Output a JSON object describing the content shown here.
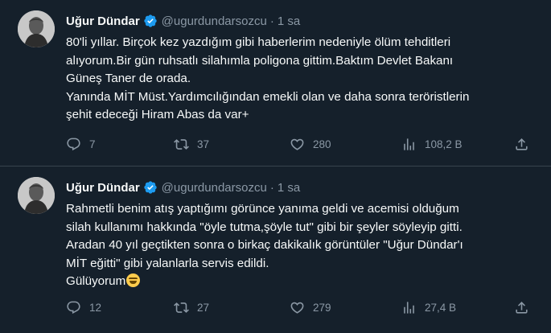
{
  "tweets": [
    {
      "author_name": "Uğur Dündar",
      "handle": "@ugurdundarsozcu",
      "separator": "·",
      "time": "1 sa",
      "text_lines": [
        "80'li yıllar. Birçok kez yazdığım gibi haberlerim nedeniyle ölüm tehditleri",
        "alıyorum.Bir gün ruhsatlı silahımla poligona gittim.Baktım Devlet Bakanı",
        "Güneş Taner de orada.",
        "Yanında MİT Müst.Yardımcılığından emekli olan ve daha sonra teröristlerin",
        "şehit edeceği Hiram Abas da var+"
      ],
      "replies": "7",
      "retweets": "37",
      "likes": "280",
      "views": "108,2 B"
    },
    {
      "author_name": "Uğur Dündar",
      "handle": "@ugurdundarsozcu",
      "separator": "·",
      "time": "1 sa",
      "text_lines": [
        "Rahmetli benim atış yaptığımı görünce yanıma geldi ve acemisi olduğum",
        "silah kullanımı hakkında \"öyle tutma,şöyle tut\" gibi bir şeyler söyleyip gitti.",
        "Aradan 40 yıl geçtikten sonra o birkaç dakikalık görüntüler \"Uğur Dündar'ı",
        "MİT eğitti\" gibi yalanlarla servis edildi.",
        "Gülüyorum"
      ],
      "emoji": "rolling-on-floor-laughing-emoji",
      "replies": "12",
      "retweets": "27",
      "likes": "279",
      "views": "27,4 B"
    }
  ],
  "colors": {
    "background": "#15202b",
    "text": "#f7f9f9",
    "secondary": "#8b98a5",
    "verified": "#1d9bf0",
    "divider": "#38444d"
  },
  "icons": [
    "verified-badge-icon",
    "reply-icon",
    "retweet-icon",
    "like-icon",
    "views-icon",
    "share-icon"
  ]
}
